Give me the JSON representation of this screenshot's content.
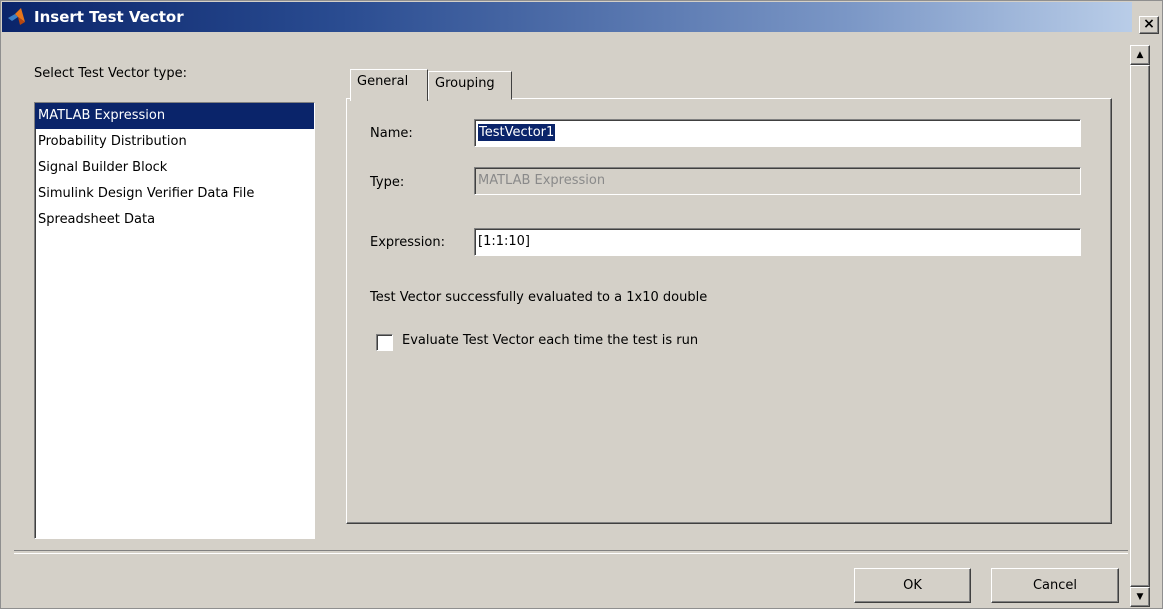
{
  "window": {
    "title": "Insert Test Vector",
    "close_label": "×"
  },
  "type_selector": {
    "label": "Select Test Vector type:",
    "items": [
      "MATLAB Expression",
      "Probability Distribution",
      "Signal Builder Block",
      "Simulink Design Verifier Data File",
      "Spreadsheet Data"
    ],
    "selected_index": 0
  },
  "tabs": [
    {
      "label": "General",
      "active": true
    },
    {
      "label": "Grouping",
      "active": false
    }
  ],
  "general": {
    "name_label": "Name:",
    "name_value": "TestVector1",
    "type_label": "Type:",
    "type_value": "MATLAB Expression",
    "expression_label": "Expression:",
    "expression_value": "[1:1:10]",
    "status": "Test Vector successfully evaluated to a 1x10 double",
    "evaluate_each_run_label": "Evaluate Test Vector each time the test is run",
    "evaluate_each_run_checked": false
  },
  "buttons": {
    "ok": "OK",
    "cancel": "Cancel"
  },
  "colors": {
    "selection": "#0a246a",
    "dialog_bg": "#d4d0c8"
  }
}
